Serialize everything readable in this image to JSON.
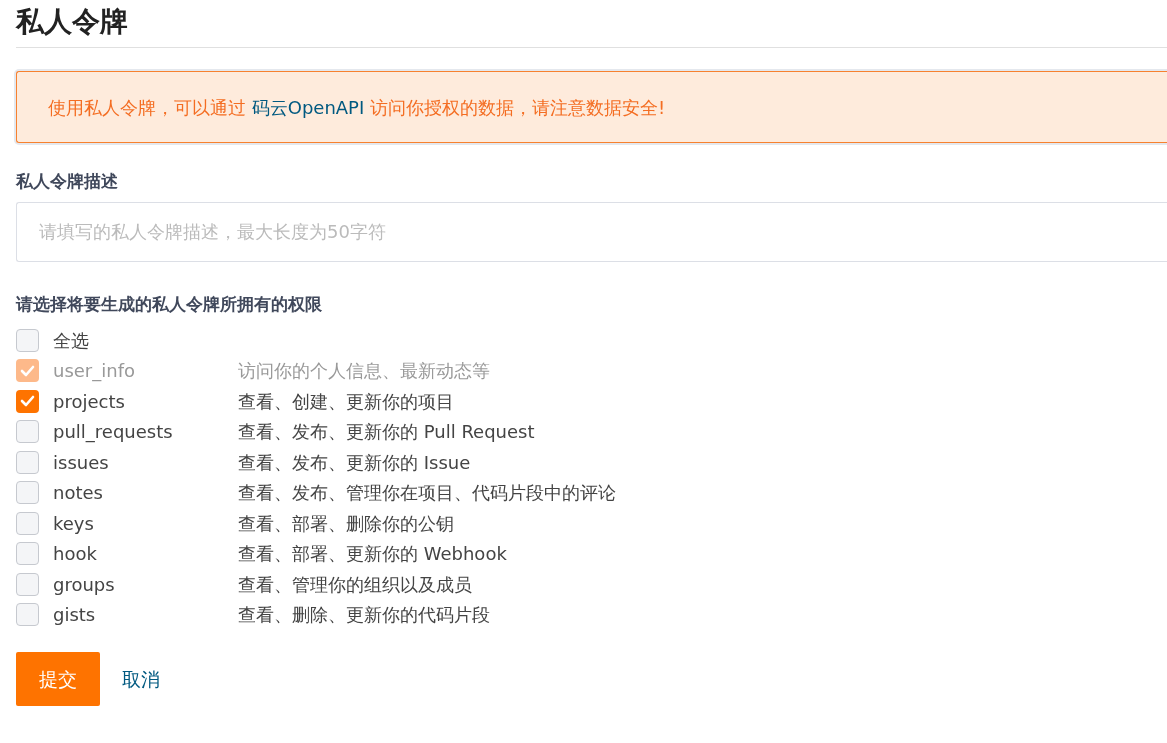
{
  "title": "私人令牌",
  "notice": {
    "text_before": "使用私人令牌，可以通过 ",
    "link": "码云OpenAPI",
    "text_after": " 访问你授权的数据，请注意数据安全!"
  },
  "description_field": {
    "label": "私人令牌描述",
    "placeholder": "请填写的私人令牌描述，最大长度为50字符"
  },
  "permissions_label": "请选择将要生成的私人令牌所拥有的权限",
  "select_all": {
    "label": "全选",
    "checked": false
  },
  "permissions": [
    {
      "name": "user_info",
      "description": "访问你的个人信息、最新动态等",
      "checked": true,
      "disabled": true
    },
    {
      "name": "projects",
      "description": "查看、创建、更新你的项目",
      "checked": true,
      "disabled": false
    },
    {
      "name": "pull_requests",
      "description": "查看、发布、更新你的 Pull Request",
      "checked": false,
      "disabled": false
    },
    {
      "name": "issues",
      "description": "查看、发布、更新你的 Issue",
      "checked": false,
      "disabled": false
    },
    {
      "name": "notes",
      "description": "查看、发布、管理你在项目、代码片段中的评论",
      "checked": false,
      "disabled": false
    },
    {
      "name": "keys",
      "description": "查看、部署、删除你的公钥",
      "checked": false,
      "disabled": false
    },
    {
      "name": "hook",
      "description": "查看、部署、更新你的 Webhook",
      "checked": false,
      "disabled": false
    },
    {
      "name": "groups",
      "description": "查看、管理你的组织以及成员",
      "checked": false,
      "disabled": false
    },
    {
      "name": "gists",
      "description": "查看、删除、更新你的代码片段",
      "checked": false,
      "disabled": false
    }
  ],
  "buttons": {
    "submit": "提交",
    "cancel": "取消"
  }
}
